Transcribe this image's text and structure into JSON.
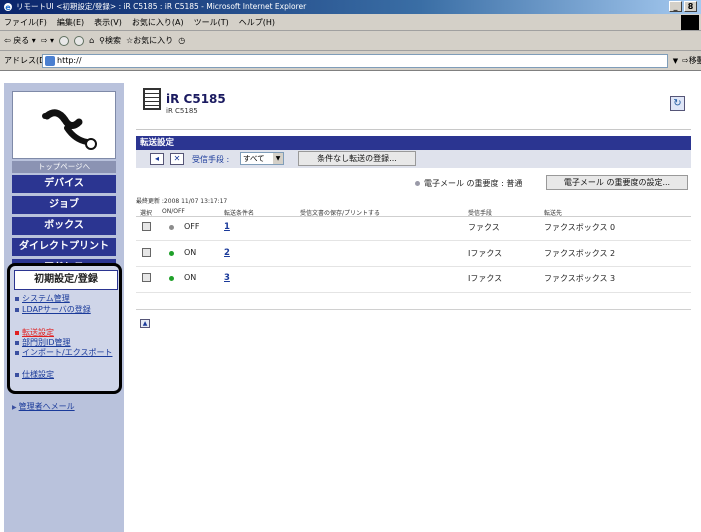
{
  "window": {
    "title": "リモートUI <初期設定/登録> : iR C5185 : iR C5185 - Microsoft Internet Explorer",
    "buttons": [
      "_",
      "8"
    ]
  },
  "menu": [
    "ファイル(F)",
    "編集(E)",
    "表示(V)",
    "お気に入り(A)",
    "ツール(T)",
    "ヘルプ(H)"
  ],
  "toolbar": {
    "back": "戻る",
    "search": "検索",
    "favorites": "お気に入り"
  },
  "address": {
    "label": "アドレス(D)",
    "url": "http://",
    "go": "移動"
  },
  "sidebar": {
    "top_page": "トップページへ",
    "nav": [
      "デバイス",
      "ジョブ",
      "ボックス",
      "ダイレクトプリント",
      "アドレス"
    ],
    "section_title": "初期設定/登録",
    "links": [
      {
        "label": "システム管理",
        "active": false
      },
      {
        "label": "LDAPサーバの登録",
        "active": false
      },
      {
        "label": "転送設定",
        "active": true
      },
      {
        "label": "部門別ID管理",
        "active": false
      },
      {
        "label": "インポート/エクスポート",
        "active": false
      },
      {
        "label": "仕様設定",
        "active": false
      }
    ],
    "mail_admin": "管理者へメール"
  },
  "device": {
    "name": "iR C5185",
    "model": "iR C5185"
  },
  "section": {
    "title": "転送設定",
    "receive_label": "受信手段 :",
    "receive_value": "すべて",
    "register_unconditional": "条件なし転送の登録...",
    "email_priority_label": "電子メール の重要度 : 普通",
    "email_priority_button": "電子メール の重要度の設定...",
    "last_updated": "最終更新 :2008 11/07 13:17:17"
  },
  "table": {
    "headers": [
      "選択",
      "ON/OFF",
      "転送条件名",
      "受信文書の保存/プリントする",
      "受信手段",
      "転送先"
    ],
    "rows": [
      {
        "status": "OFF",
        "status_color": "#8c8c8c",
        "name": "1",
        "receive": "ファクス",
        "dest": "ファクスボックス 0"
      },
      {
        "status": "ON",
        "status_color": "#1fa02a",
        "name": "2",
        "receive": "Iファクス",
        "dest": "ファクスボックス 2"
      },
      {
        "status": "ON",
        "status_color": "#1fa02a",
        "name": "3",
        "receive": "Iファクス",
        "dest": "ファクスボックス 3"
      }
    ]
  },
  "colors": {
    "nav": "#2b3591",
    "sidebar_bg": "#b9c2dc",
    "active_link": "#e02020",
    "link": "#1a3a9a"
  }
}
